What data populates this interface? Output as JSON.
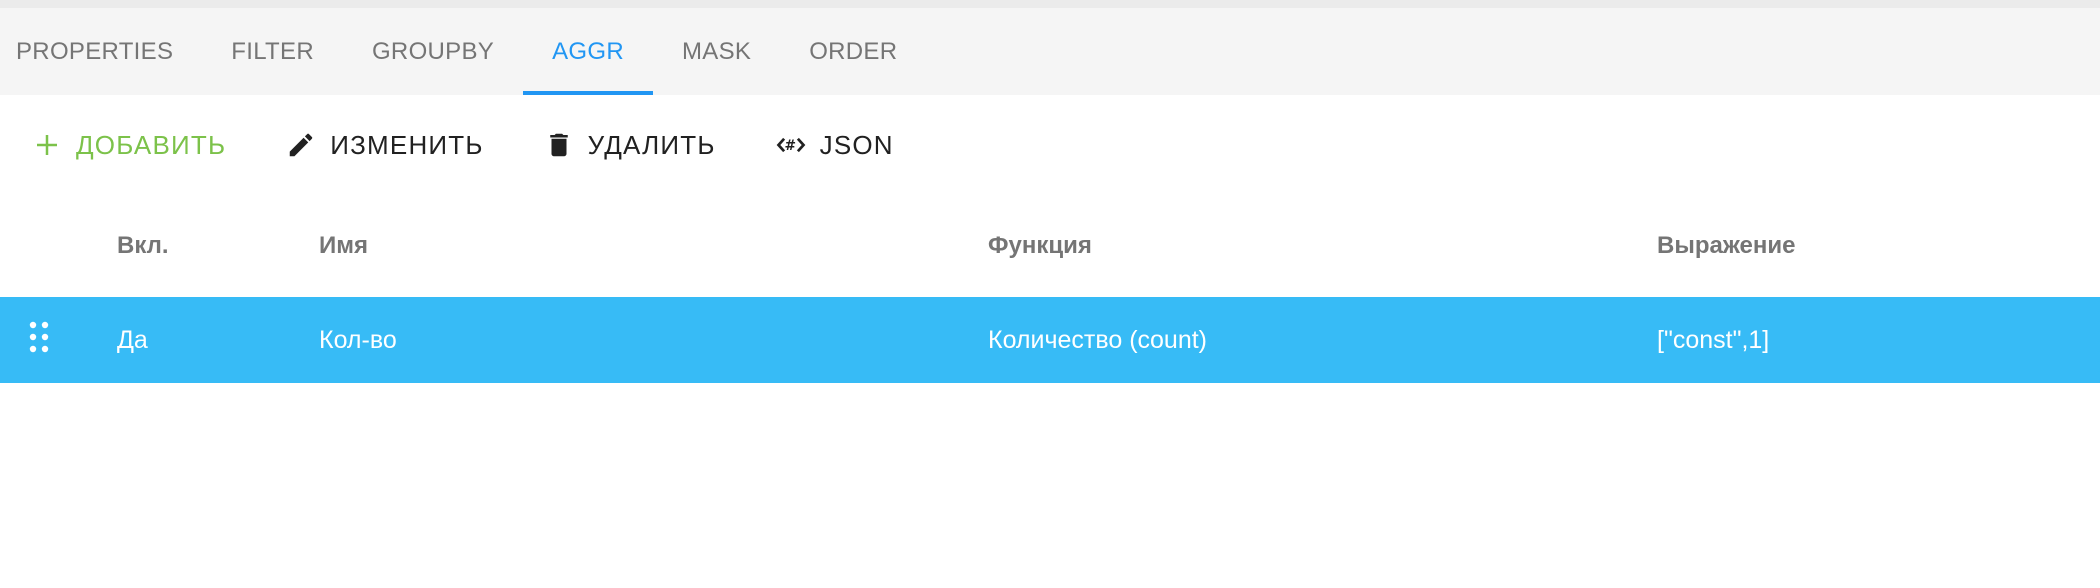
{
  "tabs": [
    {
      "label": "PROPERTIES"
    },
    {
      "label": "FILTER"
    },
    {
      "label": "GROUPBY"
    },
    {
      "label": "AGGR"
    },
    {
      "label": "MASK"
    },
    {
      "label": "ORDER"
    }
  ],
  "active_tab": "AGGR",
  "toolbar": {
    "add_label": "ДОБАВИТЬ",
    "edit_label": "ИЗМЕНИТЬ",
    "delete_label": "УДАЛИТЬ",
    "json_label": "JSON"
  },
  "table": {
    "columns": [
      "Вкл.",
      "Имя",
      "Функция",
      "Выражение"
    ],
    "rows": [
      {
        "enabled": "Да",
        "name": "Кол-во",
        "function": "Количество (count)",
        "expression": "[\"const\",1]"
      }
    ]
  },
  "colors": {
    "accent": "#2196f3",
    "add": "#7cc24a",
    "selected_row": "#37bbf6"
  },
  "icons": {
    "add": "plus-icon",
    "edit": "pencil-icon",
    "delete": "trash-icon",
    "json": "code-icon",
    "drag": "drag-handle-icon"
  }
}
